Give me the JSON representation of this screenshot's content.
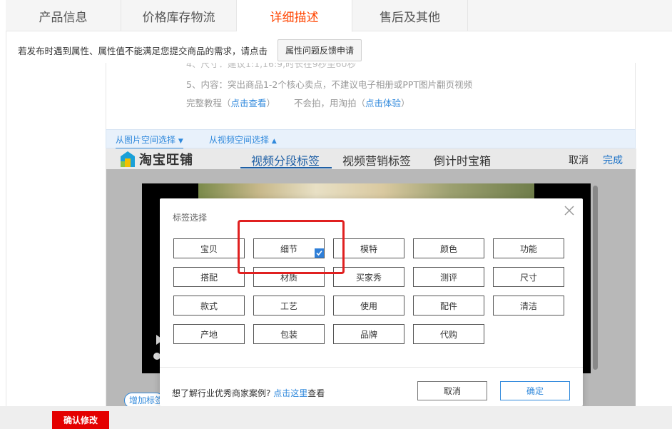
{
  "tabs": [
    {
      "label": "产品信息",
      "active": false
    },
    {
      "label": "价格库存物流",
      "active": false
    },
    {
      "label": "详细描述",
      "active": true
    },
    {
      "label": "售后及其他",
      "active": false
    }
  ],
  "notice": {
    "text": "若发布时遇到属性、属性值不能满足您提交商品的需求，请点击",
    "button_label": "属性问题反馈申请"
  },
  "tips": {
    "cut_line": "4、尺寸：建议1:1,16:9,时长在9秒至60秒",
    "line5": "5、内容：突出商品1-2个核心卖点，不建议电子相册或PPT图片翻页视频",
    "tutorial_prefix": "完整教程（",
    "tutorial_link": "点击查看",
    "tutorial_suffix": "）",
    "taopai_prefix": "不会拍，用淘拍（",
    "taopai_link": "点击体验",
    "taopai_suffix": "）"
  },
  "space_bar": {
    "image_space": "从图片空间选择",
    "video_space": "从视频空间选择"
  },
  "editor": {
    "logo_text": "淘宝旺铺",
    "tabs": [
      "视频分段标签",
      "视频营销标签",
      "倒计时宝箱"
    ],
    "cancel": "取消",
    "done": "完成",
    "add_tag": "增加标签"
  },
  "dialog": {
    "title": "标签选择",
    "tags": [
      {
        "label": "宝贝",
        "checked": false
      },
      {
        "label": "细节",
        "checked": true
      },
      {
        "label": "模特",
        "checked": false
      },
      {
        "label": "颜色",
        "checked": false
      },
      {
        "label": "功能",
        "checked": false
      },
      {
        "label": "搭配",
        "checked": false
      },
      {
        "label": "材质",
        "checked": false
      },
      {
        "label": "买家秀",
        "checked": false
      },
      {
        "label": "测评",
        "checked": false
      },
      {
        "label": "尺寸",
        "checked": false
      },
      {
        "label": "款式",
        "checked": false
      },
      {
        "label": "工艺",
        "checked": false
      },
      {
        "label": "使用",
        "checked": false
      },
      {
        "label": "配件",
        "checked": false
      },
      {
        "label": "清洁",
        "checked": false
      },
      {
        "label": "产地",
        "checked": false
      },
      {
        "label": "包装",
        "checked": false
      },
      {
        "label": "品牌",
        "checked": false
      },
      {
        "label": "代购",
        "checked": false
      }
    ],
    "footer_prefix": "想了解行业优秀商家案例? ",
    "footer_link": "点击这里",
    "footer_suffix": "查看",
    "cancel": "取消",
    "confirm": "确定"
  },
  "bottom": {
    "confirm_label": "确认修改"
  },
  "colors": {
    "accent_orange": "#ff4400",
    "link_blue": "#3089dc",
    "highlight_red": "#e02020",
    "confirm_red": "#e40000"
  }
}
